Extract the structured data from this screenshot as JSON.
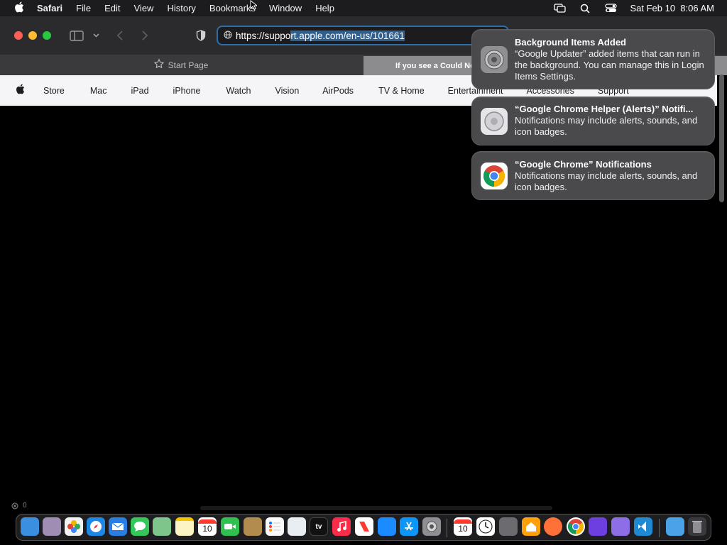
{
  "menubar": {
    "app_name": "Safari",
    "items": [
      "File",
      "Edit",
      "View",
      "History",
      "Bookmarks",
      "Window",
      "Help"
    ],
    "clock": "Sat Feb 10  8:06 AM"
  },
  "toolbar": {
    "url_prefix": "https://suppo",
    "url_selected": "rt.apple.com/en-us/101661"
  },
  "tabs": {
    "start_page": "Start Page",
    "active_title": "If you see a Could No"
  },
  "apple_nav": {
    "items": [
      "Store",
      "Mac",
      "iPad",
      "iPhone",
      "Watch",
      "Vision",
      "AirPods",
      "TV & Home",
      "Entertainment",
      "Accessories",
      "Support"
    ]
  },
  "notifications": [
    {
      "title": "Background Items Added",
      "body": "“Google Updater” added items that can run in the background. You can manage this in Login Items Settings.",
      "icon": "settings-gear-icon"
    },
    {
      "title": "“Google Chrome Helper (Alerts)” Notifi...",
      "body": "Notifications may include alerts, sounds, and icon badges.",
      "icon": "chrome-helper-icon"
    },
    {
      "title": "“Google Chrome” Notifications",
      "body": "Notifications may include alerts, sounds, and icon badges.",
      "icon": "chrome-icon"
    }
  ],
  "statusbar": {
    "counts": "0"
  },
  "dock": {
    "calendar_day": "10",
    "calendar_day_2": "10",
    "tv_label": "tv"
  },
  "colors": {
    "accent": "#2f6ea8",
    "notification_bg": "#4a4a4c",
    "nav_bg": "#f5f5f7"
  }
}
